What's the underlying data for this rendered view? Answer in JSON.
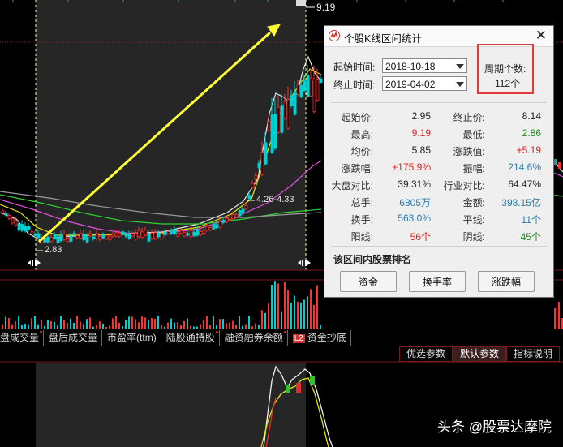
{
  "chart": {
    "high_marker": "9.19",
    "partial_price": "8.",
    "range_label": "4.26-4.33",
    "low_marker": "2.83"
  },
  "indicator_tabs": [
    {
      "label": "盘成交量"
    },
    {
      "label": "盘后成交量"
    },
    {
      "label": "市盈率(ttm)"
    },
    {
      "label": "陆股通持股"
    },
    {
      "label": "融资融券余额"
    },
    {
      "label": "资金抄底",
      "badge": "L2"
    }
  ],
  "param_tabs": {
    "optional": "优选参数",
    "default": "默认参数",
    "help": "指标说明"
  },
  "dialog": {
    "title": "个股K线区间统计",
    "start_label": "起始时间:",
    "start_date": "2018-10-18",
    "end_label": "终止时间:",
    "end_date": "2019-04-02",
    "period_label": "周期个数:",
    "period_value": "112个",
    "stats": [
      {
        "l1": "起始价:",
        "v1": "2.95",
        "c1": "dark",
        "l2": "终止价:",
        "v2": "8.14",
        "c2": "dark"
      },
      {
        "l1": "最高:",
        "v1": "9.19",
        "c1": "red",
        "l2": "最低:",
        "v2": "2.86",
        "c2": "green"
      },
      {
        "l1": "均价:",
        "v1": "5.85",
        "c1": "dark",
        "l2": "涨跌值:",
        "v2": "+5.19",
        "c2": "red"
      },
      {
        "l1": "涨跌幅:",
        "v1": "+175.9%",
        "c1": "red",
        "l2": "振幅:",
        "v2": "214.6%",
        "c2": "blue"
      },
      {
        "l1": "大盘对比:",
        "v1": "39.31%",
        "c1": "dark",
        "l2": "行业对比:",
        "v2": "64.47%",
        "c2": "dark"
      },
      {
        "l1": "总手:",
        "v1": "6805万",
        "c1": "blue",
        "l2": "金额:",
        "v2": "398.15亿",
        "c2": "blue"
      },
      {
        "l1": "换手:",
        "v1": "563.0%",
        "c1": "blue",
        "l2": "平线:",
        "v2": "11个",
        "c2": "blue"
      },
      {
        "l1": "阳线:",
        "v1": "56个",
        "c1": "red",
        "l2": "阴线:",
        "v2": "45个",
        "c2": "green"
      }
    ],
    "rank_title": "该区间内股票排名",
    "buttons": {
      "capital": "资金",
      "turnover": "换手率",
      "change": "涨跌幅"
    }
  },
  "watermark": "头条 @股票达摩院",
  "colors": {
    "up": "#ff3030",
    "down": "#00d0d0",
    "arrow": "#ffff33",
    "selection_border": "#ffff99",
    "highlight_box": "#e03a3a"
  }
}
